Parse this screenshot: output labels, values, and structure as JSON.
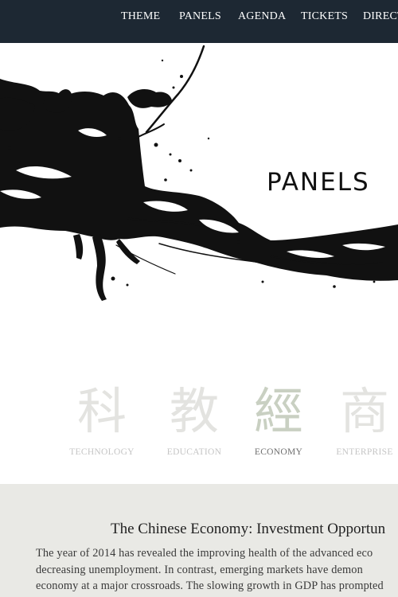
{
  "nav": {
    "items": [
      {
        "label": "THEME"
      },
      {
        "label": "PANELS"
      },
      {
        "label": "AGENDA"
      },
      {
        "label": "TICKETS"
      },
      {
        "label": "DIRECT"
      }
    ]
  },
  "hero": {
    "title": "PANELS"
  },
  "categories": [
    {
      "glyph": "科",
      "label": "TECHNOLOGY",
      "active": false
    },
    {
      "glyph": "教",
      "label": "EDUCATION",
      "active": false
    },
    {
      "glyph": "經",
      "label": "ECONOMY",
      "active": true
    },
    {
      "glyph": "商",
      "label": "ENTERPRISE",
      "active": false
    }
  ],
  "article": {
    "title": "The Chinese Economy: Investment Opportun",
    "lines": [
      "The year of 2014 has revealed the improving health of the advanced eco",
      "decreasing unemployment. In contrast, emerging markets have demon",
      "economy at a major crossroads. The slowing growth in GDP has prompted"
    ]
  },
  "colors": {
    "nav_bg": "#1d2833",
    "nav_text": "#ffffff",
    "ink": "#111111",
    "article_bg": "#e9e9e5",
    "glyph_inactive": "#e3e3e0",
    "glyph_active": "#c9d0c2"
  }
}
